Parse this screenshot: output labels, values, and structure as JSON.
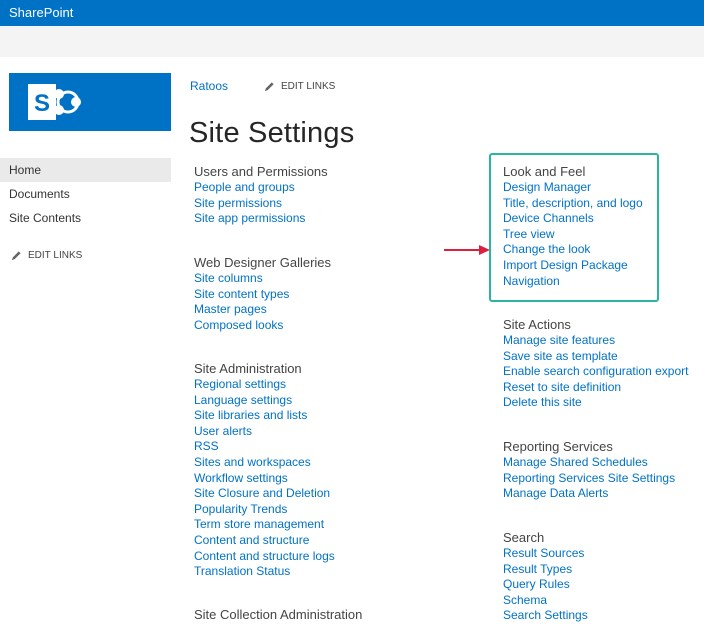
{
  "suitebar": {
    "brand": "SharePoint"
  },
  "header": {
    "site_link": "Ratoos",
    "edit_links": "EDIT LINKS",
    "title": "Site Settings"
  },
  "left_nav": {
    "items": [
      {
        "label": "Home"
      },
      {
        "label": "Documents"
      },
      {
        "label": "Site Contents"
      }
    ],
    "edit_links": "EDIT LINKS"
  },
  "sections": {
    "users_permissions": {
      "heading": "Users and Permissions",
      "links": [
        "People and groups",
        "Site permissions",
        "Site app permissions"
      ]
    },
    "web_designer_galleries": {
      "heading": "Web Designer Galleries",
      "links": [
        "Site columns",
        "Site content types",
        "Master pages",
        "Composed looks"
      ]
    },
    "site_administration": {
      "heading": "Site Administration",
      "links": [
        "Regional settings",
        "Language settings",
        "Site libraries and lists",
        "User alerts",
        "RSS",
        "Sites and workspaces",
        "Workflow settings",
        "Site Closure and Deletion",
        "Popularity Trends",
        "Term store management",
        "Content and structure",
        "Content and structure logs",
        "Translation Status"
      ]
    },
    "site_collection_administration": {
      "heading": "Site Collection Administration"
    },
    "look_and_feel": {
      "heading": "Look and Feel",
      "links": [
        "Design Manager",
        "Title, description, and logo",
        "Device Channels",
        "Tree view",
        "Change the look",
        "Import Design Package",
        "Navigation"
      ]
    },
    "site_actions": {
      "heading": "Site Actions",
      "links": [
        "Manage site features",
        "Save site as template",
        "Enable search configuration export",
        "Reset to site definition",
        "Delete this site"
      ]
    },
    "reporting_services": {
      "heading": "Reporting Services",
      "links": [
        "Manage Shared Schedules",
        "Reporting Services Site Settings",
        "Manage Data Alerts"
      ]
    },
    "search": {
      "heading": "Search",
      "links": [
        "Result Sources",
        "Result Types",
        "Query Rules",
        "Schema",
        "Search Settings"
      ]
    }
  },
  "colors": {
    "brand_blue": "#0072c6",
    "highlight": "#2bb5a0",
    "arrow": "#d9203f"
  }
}
